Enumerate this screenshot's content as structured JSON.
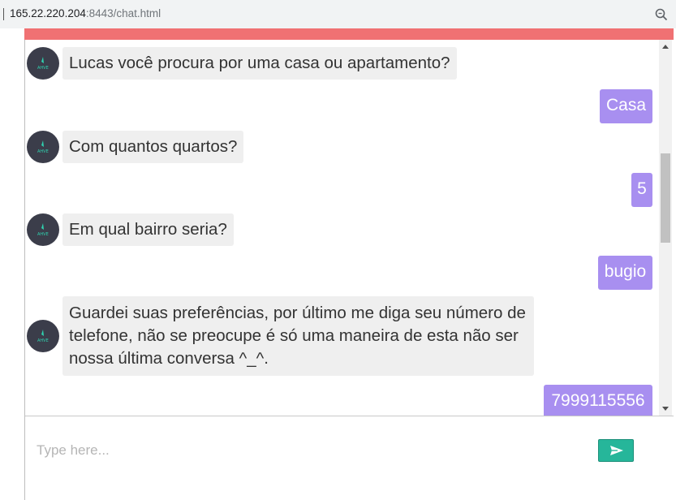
{
  "browser": {
    "url_host": "165.22.220.204",
    "url_rest": ":8443/chat.html",
    "zoom_icon": "zoom-magnifier-icon"
  },
  "colors": {
    "header_bar": "#f07173",
    "bot_bubble": "#efefef",
    "user_bubble": "#a88ff0",
    "avatar_bg": "#3b3d4a",
    "send_button": "#26b69a"
  },
  "messages": [
    {
      "from": "bot",
      "text": "Lucas você procura por uma casa ou apartamento?"
    },
    {
      "from": "user",
      "text": "Casa"
    },
    {
      "from": "bot",
      "text": "Com quantos quartos?"
    },
    {
      "from": "user",
      "text": "5"
    },
    {
      "from": "bot",
      "text": "Em qual bairro seria?"
    },
    {
      "from": "user",
      "text": "bugio"
    },
    {
      "from": "bot",
      "text": "Guardei suas preferências, por último me diga seu número de telefone, não se preocupe é só uma maneira de esta não ser nossa última conversa ^_^."
    },
    {
      "from": "user",
      "text": "7999115556"
    }
  ],
  "composer": {
    "placeholder": "Type here...",
    "send_icon": "send-arrow-icon"
  }
}
